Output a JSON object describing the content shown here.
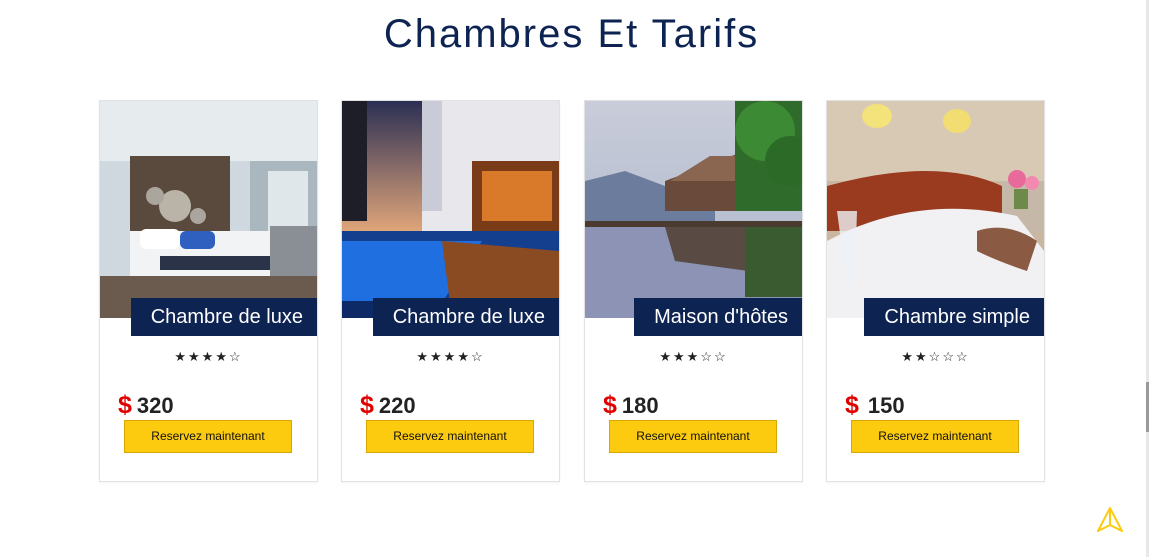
{
  "section": {
    "title": "Chambres Et Tarifs"
  },
  "rooms": [
    {
      "name": "Chambre de luxe",
      "rating": 4,
      "max_rating": 5,
      "stars_text": "★★★★☆",
      "currency": "$",
      "price": "320",
      "button": "Reservez maintenant"
    },
    {
      "name": "Chambre de luxe",
      "rating": 4,
      "max_rating": 5,
      "stars_text": "★★★★☆",
      "currency": "$",
      "price": "220",
      "button": "Reservez maintenant"
    },
    {
      "name": "Maison d'hôtes",
      "rating": 3,
      "max_rating": 5,
      "stars_text": "★★★☆☆",
      "currency": "$",
      "price": "180",
      "button": "Reservez maintenant"
    },
    {
      "name": "Chambre simple",
      "rating": 2,
      "max_rating": 5,
      "stars_text": "★★☆☆☆",
      "currency": "$",
      "price": "150",
      "button": "Reservez maintenant"
    }
  ],
  "icons": {
    "scroll_top": "navigation-arrow-icon"
  },
  "colors": {
    "navy": "#0d2352",
    "button": "#fccb0f",
    "currency": "#e00000"
  }
}
